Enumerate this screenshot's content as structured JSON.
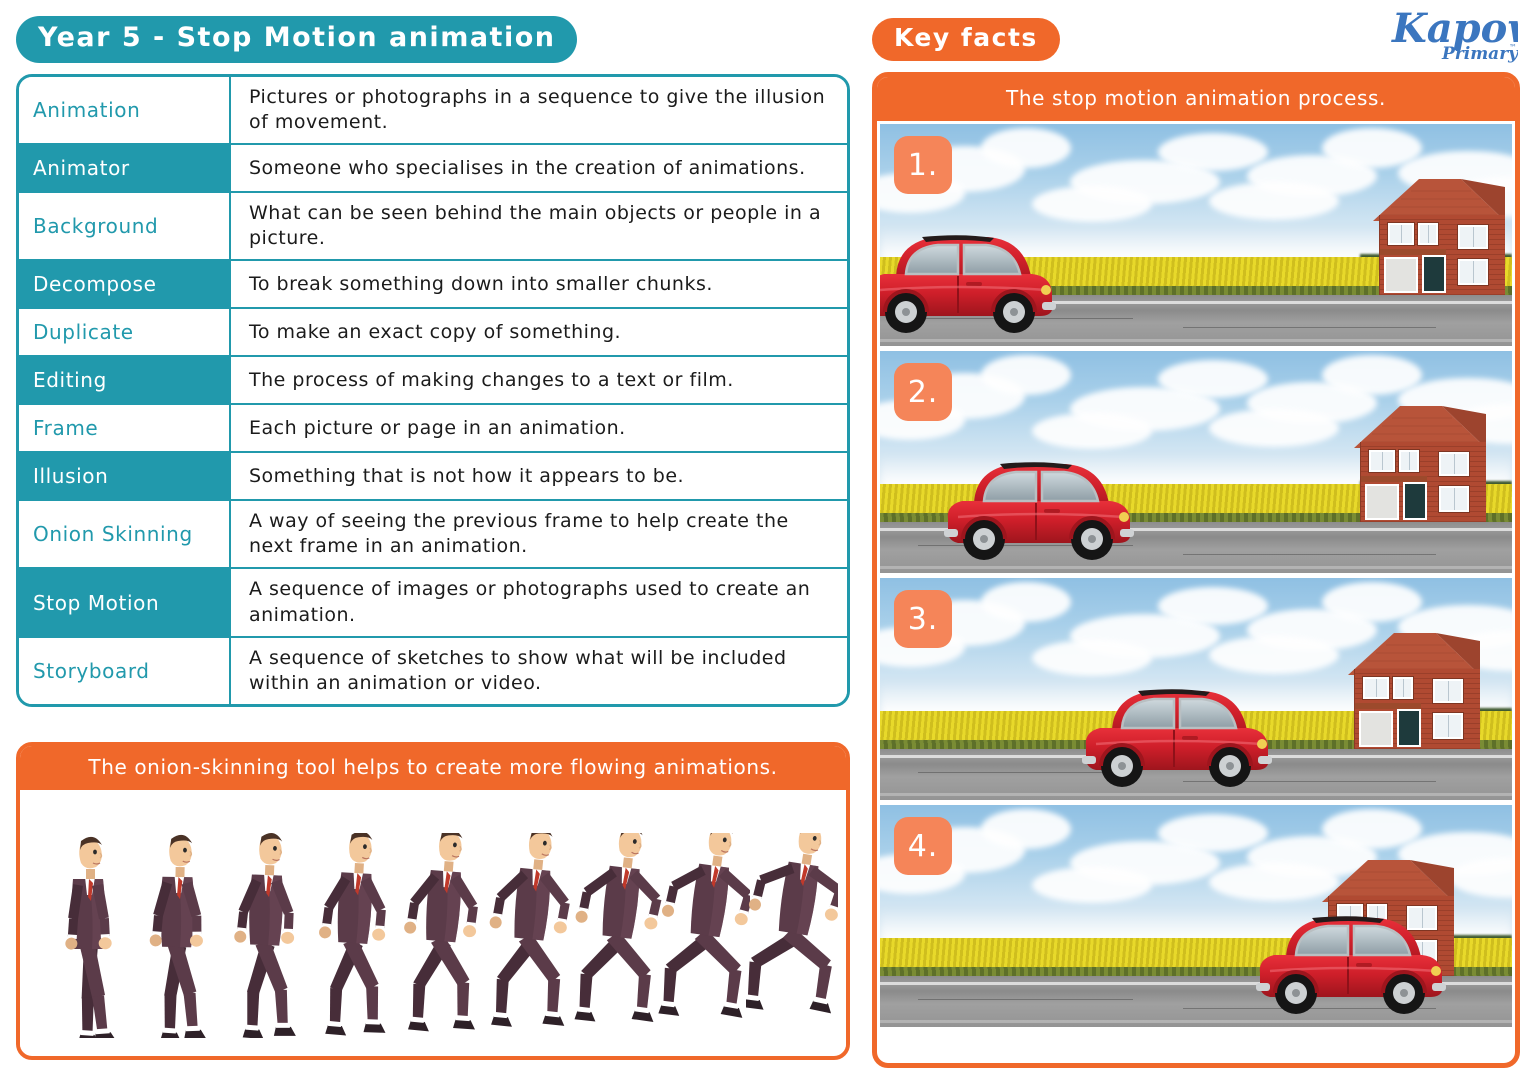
{
  "header": {
    "title": "Year 5 - Stop Motion animation",
    "key_facts_label": "Key facts",
    "logo_main": "Kapow",
    "logo_sub": "Primary",
    "logo_tm": "™",
    "logo_color": "#3B76BF"
  },
  "colors": {
    "teal": "#2199AC",
    "orange": "#F0682A",
    "badge_orange": "#F58559",
    "white": "#FFFFFF"
  },
  "vocabulary": {
    "rows": [
      {
        "term": "Animation",
        "definition": "Pictures or photographs in a sequence to give the illusion of movement.",
        "style": "light"
      },
      {
        "term": "Animator",
        "definition": "Someone who specialises in the creation of animations.",
        "style": "dark"
      },
      {
        "term": "Background",
        "definition": "What can be seen behind the main objects or people in a picture.",
        "style": "light"
      },
      {
        "term": "Decompose",
        "definition": "To break something down into smaller chunks.",
        "style": "dark"
      },
      {
        "term": "Duplicate",
        "definition": "To make an exact copy of something.",
        "style": "light"
      },
      {
        "term": "Editing",
        "definition": "The process of making changes to a text or film.",
        "style": "dark"
      },
      {
        "term": "Frame",
        "definition": "Each picture or page in an animation.",
        "style": "light"
      },
      {
        "term": "Illusion",
        "definition": "Something that is not how it appears to be.",
        "style": "dark"
      },
      {
        "term": "Onion Skinning",
        "definition": "A way of seeing the previous frame to help create the next frame in an animation.",
        "style": "light"
      },
      {
        "term": "Stop Motion",
        "definition": "A sequence of images or photographs used to create an animation.",
        "style": "dark"
      },
      {
        "term": "Storyboard",
        "definition": "A sequence of sketches to show what will be included within an animation or video.",
        "style": "light"
      }
    ]
  },
  "onion_card": {
    "header": "The onion-skinning tool helps to create more flowing animations.",
    "figure_count": 9,
    "figure_description": "walking-to-running man in a purple suit with red tie"
  },
  "process_card": {
    "header": "The stop motion animation process.",
    "frames": [
      {
        "number": "1.",
        "scene": "red car at far left of road, house at right"
      },
      {
        "number": "2.",
        "scene": "red car moved slightly right along the road"
      },
      {
        "number": "3.",
        "scene": "red car near centre-right of road"
      },
      {
        "number": "4.",
        "scene": "red car at far right in front of the house"
      }
    ]
  }
}
